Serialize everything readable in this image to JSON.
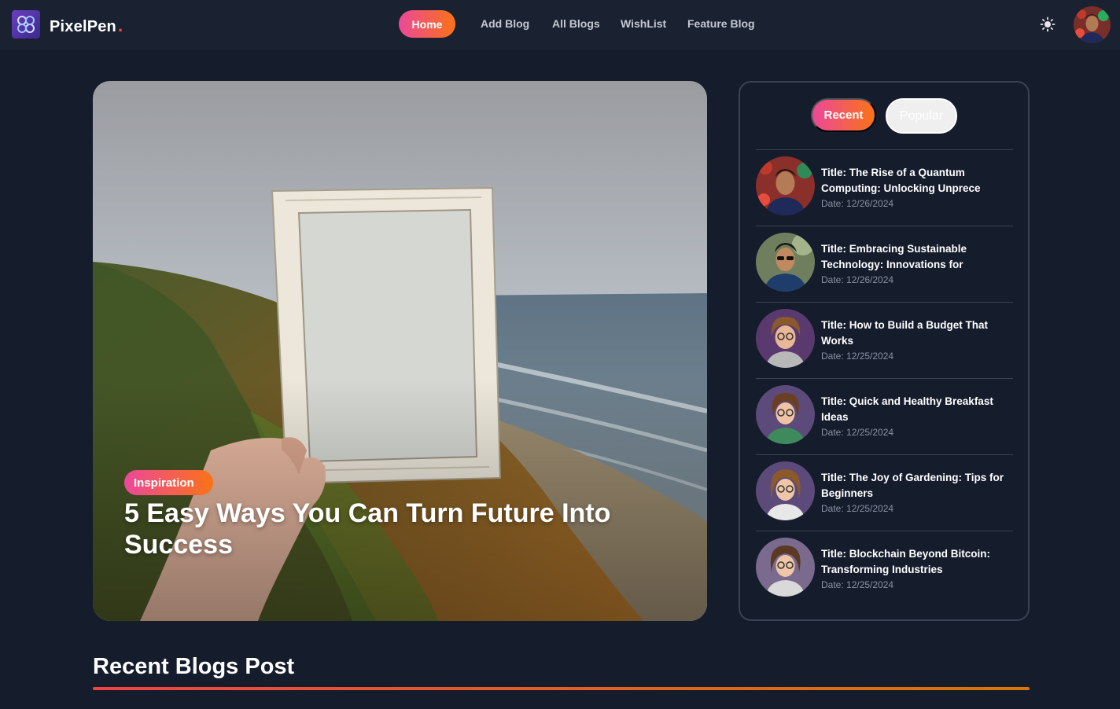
{
  "navbar": {
    "brand": "PixelPen",
    "brand_dot": ".",
    "links": {
      "home": "Home",
      "add_blog": "Add Blog",
      "all_blogs": "All Blogs",
      "wishlist": "WishList",
      "feature_blog": "Feature Blog"
    },
    "theme_icon": "sun-icon",
    "accent_gradient": [
      "#ec4899",
      "#f97316"
    ]
  },
  "hero": {
    "tag": "Inspiration",
    "title": "5 Easy Ways You Can Turn Future Into Success"
  },
  "sidebar": {
    "tabs": {
      "recent": "Recent",
      "popular": "Popular"
    },
    "items": [
      {
        "title": "Title: The Rise of a Quantum Computing: Unlocking Unprece",
        "date": "Date: 12/26/2024"
      },
      {
        "title": "Title: Embracing Sustainable Technology: Innovations for",
        "date": "Date: 12/26/2024"
      },
      {
        "title": "Title: How to Build a Budget That Works",
        "date": "Date: 12/25/2024"
      },
      {
        "title": "Title: Quick and Healthy Breakfast Ideas",
        "date": "Date: 12/25/2024"
      },
      {
        "title": "Title: The Joy of Gardening: Tips for Beginners",
        "date": "Date: 12/25/2024"
      },
      {
        "title": "Title: Blockchain Beyond Bitcoin: Transforming Industries",
        "date": "Date: 12/25/2024"
      }
    ]
  },
  "section": {
    "title": "Recent Blogs Post"
  },
  "colors": {
    "background": "#151c2c",
    "navbar": "#1a2130",
    "underline_start": "#ef4444",
    "underline_end": "#d97706"
  }
}
